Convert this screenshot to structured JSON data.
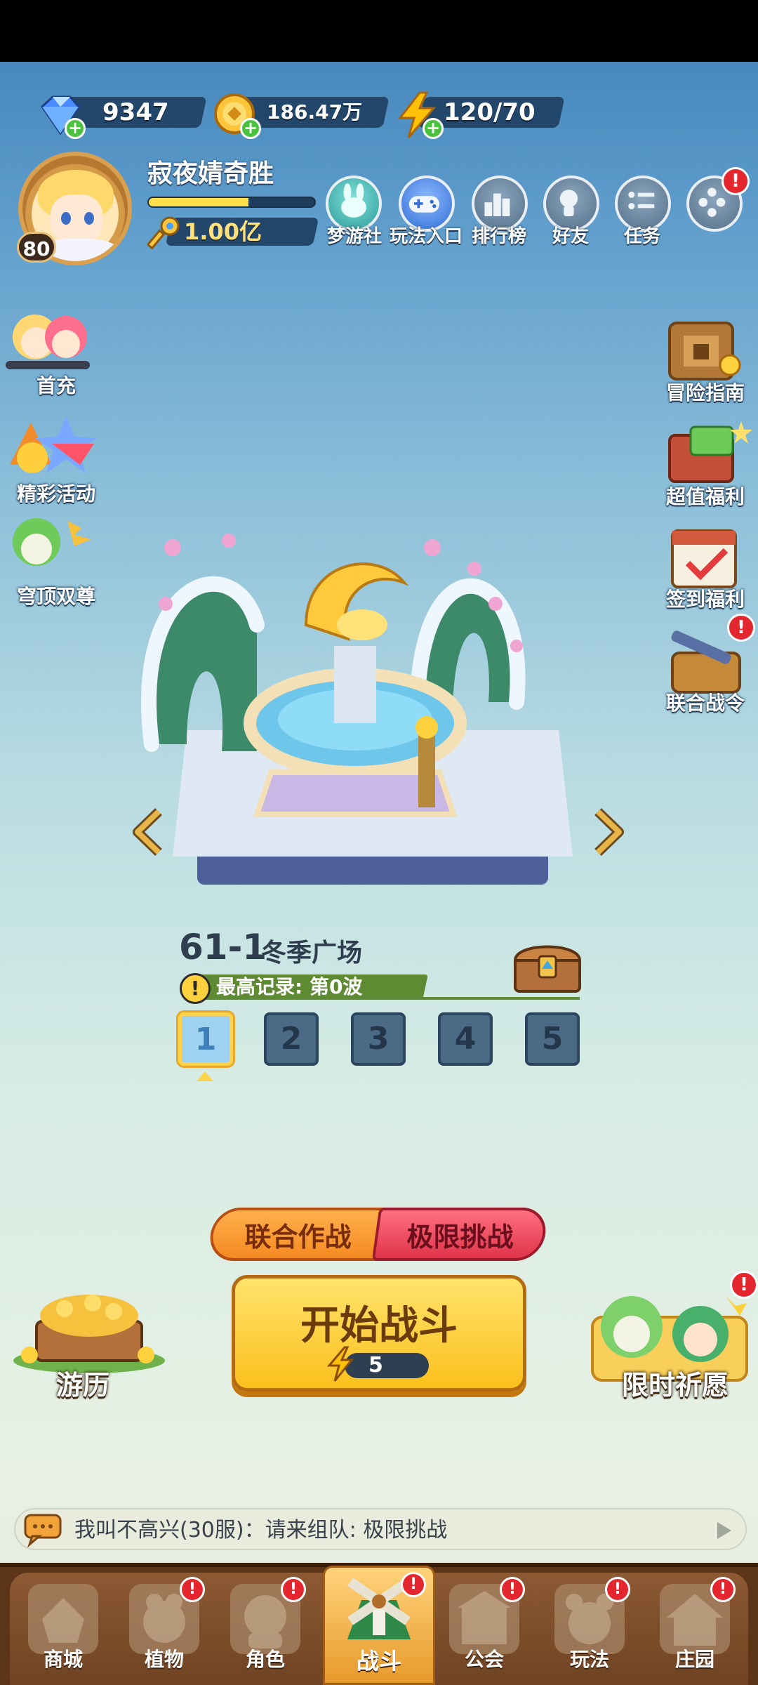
{
  "currencies": [
    {
      "name": "diamond",
      "value": "9347",
      "icon": "diamond-icon",
      "color": "#4a8cff"
    },
    {
      "name": "coin",
      "value": "186.47万",
      "icon": "coin-icon",
      "color": "#ffc53a"
    },
    {
      "name": "energy",
      "value": "120/70",
      "icon": "lightning-icon",
      "color": "#ffc107"
    }
  ],
  "player": {
    "nickname": "寂夜婧奇胜",
    "level": "80",
    "xp_fraction": 0.6,
    "keys": "1.00亿"
  },
  "top_menu": [
    {
      "label": "梦游社",
      "icon": "rabbit-icon",
      "badge": false
    },
    {
      "label": "玩法入口",
      "icon": "gamepad-icon",
      "badge": false
    },
    {
      "label": "排行榜",
      "icon": "ranking-icon",
      "badge": false
    },
    {
      "label": "好友",
      "icon": "friend-icon",
      "badge": false
    },
    {
      "label": "任务",
      "icon": "task-icon",
      "badge": false
    },
    {
      "label": "",
      "icon": "more-icon",
      "badge": true
    }
  ],
  "left_side": [
    {
      "label": "首充",
      "icon": "first-recharge-icon"
    },
    {
      "label": "精彩活动",
      "icon": "event-icon"
    },
    {
      "label": "穹顶双尊",
      "icon": "dome-icon"
    }
  ],
  "right_side": [
    {
      "label": "冒险指南",
      "icon": "guide-book-icon",
      "badge": false
    },
    {
      "label": "超值福利",
      "icon": "gift-icon",
      "badge": false
    },
    {
      "label": "签到福利",
      "icon": "calendar-icon",
      "badge": false
    },
    {
      "label": "联合战令",
      "icon": "battle-pass-icon",
      "badge": true
    }
  ],
  "stage": {
    "number": "61-1",
    "name": "冬季广场",
    "record": "最高记录: 第0波",
    "waves": [
      "1",
      "2",
      "3",
      "4",
      "5"
    ],
    "selected_wave": "1"
  },
  "modes": {
    "coop": "联合作战",
    "limit": "极限挑战"
  },
  "start": {
    "title": "开始战斗",
    "cost": "5"
  },
  "bottom_side": {
    "left": "游历",
    "right": "限时祈愿"
  },
  "chat": {
    "text": "我叫不高兴(30服)：请来组队: 极限挑战"
  },
  "nav": [
    {
      "label": "商城",
      "icon": "shop-icon",
      "badge": false
    },
    {
      "label": "植物",
      "icon": "plant-icon",
      "badge": true
    },
    {
      "label": "角色",
      "icon": "character-icon",
      "badge": true
    },
    {
      "label": "战斗",
      "icon": "battle-icon",
      "badge": true,
      "active": true
    },
    {
      "label": "公会",
      "icon": "guild-icon",
      "badge": true
    },
    {
      "label": "玩法",
      "icon": "gameplay-icon",
      "badge": true
    },
    {
      "label": "庄园",
      "icon": "manor-icon",
      "badge": true
    }
  ],
  "colors": {
    "accent_yellow": "#fbc01c",
    "coop_orange": "#f68a21",
    "limit_red": "#e0344a",
    "badge_red": "#e4272f"
  }
}
